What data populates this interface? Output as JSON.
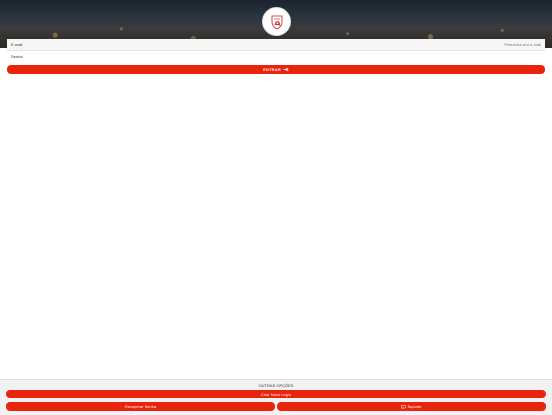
{
  "header": {},
  "login": {
    "email_label": "E-mail",
    "email_placeholder": "Preencha seu e-mail",
    "password_label": "Senha",
    "submit_label": "ENTRAR"
  },
  "footer": {
    "title": "OUTRAS OPÇÕES",
    "new_user_label": "Criar Novo Login",
    "recover_label": "Recuperar Senha",
    "support_label": "Suporte"
  },
  "colors": {
    "accent": "#e8250c",
    "header_dark": "#1b232c"
  },
  "icons": {
    "submit_icon": "login-arrow-icon",
    "support_icon": "chat-icon",
    "logo": "shield-crest-logo"
  }
}
